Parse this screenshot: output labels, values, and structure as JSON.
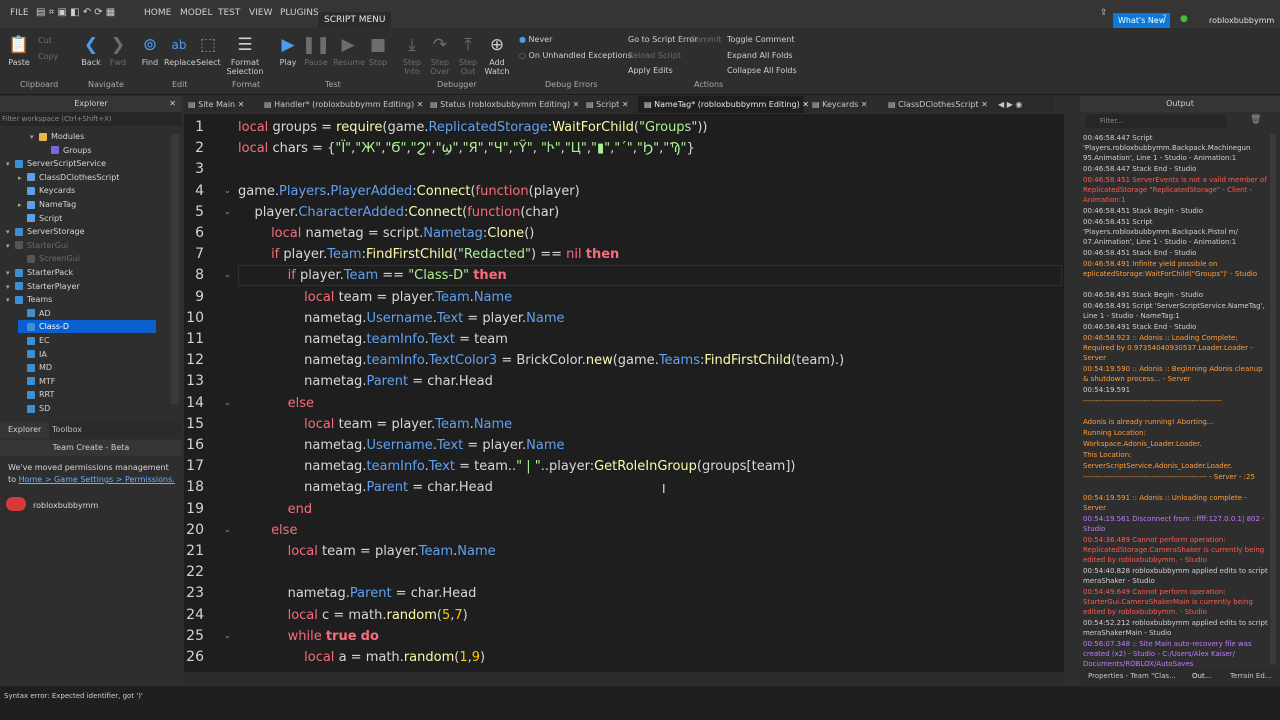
{
  "menu": {
    "file": "FILE",
    "tabs": [
      "HOME",
      "MODEL",
      "TEST",
      "VIEW",
      "PLUGINS",
      "SCRIPT MENU"
    ],
    "whats_new": "What's New",
    "username": "robloxbubbymm"
  },
  "ribbon": {
    "clipboard": {
      "paste": "Paste",
      "cut": "Cut",
      "copy": "Copy",
      "label": "Clipboard"
    },
    "navigate": {
      "back": "Back",
      "fwd": "Fwd",
      "label": "Navigate"
    },
    "edit": {
      "find": "Find",
      "replace": "Replace",
      "select": "Select",
      "label": "Edit"
    },
    "format": {
      "format_selection": "Format\nSelection",
      "label": "Format"
    },
    "test": {
      "play": "Play",
      "pause": "Pause",
      "resume": "Resume",
      "stop": "Stop",
      "label": "Test"
    },
    "debugger": {
      "step_into": "Step\nInto",
      "step_over": "Step\nOver",
      "step_out": "Step\nOut",
      "add_watch": "Add\nWatch",
      "label": "Debugger"
    },
    "debug_errors": {
      "never": "Never",
      "on_unhandled": "On Unhandled Exceptions",
      "label": "Debug Errors"
    },
    "actions": {
      "go_to_error": "Go to Script Error",
      "commit": "Commit",
      "reload": "Reload Script",
      "apply_edits": "Apply Edits",
      "toggle_comment": "Toggle Comment",
      "expand_all": "Expand All Folds",
      "collapse_all": "Collapse All Folds",
      "label": "Actions"
    }
  },
  "explorer": {
    "title": "Explorer",
    "filter_placeholder": "Filter workspace (Ctrl+Shift+X)",
    "items": [
      {
        "label": "Modules",
        "indent": 2,
        "icon": "folder"
      },
      {
        "label": "Groups",
        "indent": 3,
        "icon": "module"
      },
      {
        "label": "ServerScriptService",
        "indent": 0,
        "icon": "service"
      },
      {
        "label": "ClassDClothesScript",
        "indent": 1,
        "icon": "script"
      },
      {
        "label": "Keycards",
        "indent": 1,
        "icon": "script"
      },
      {
        "label": "NameTag",
        "indent": 1,
        "icon": "script"
      },
      {
        "label": "Script",
        "indent": 1,
        "icon": "script"
      },
      {
        "label": "ServerStorage",
        "indent": 0,
        "icon": "service"
      },
      {
        "label": "StarterGui",
        "indent": 0,
        "icon": "service",
        "dim": true
      },
      {
        "label": "ScreenGui",
        "indent": 1,
        "icon": "gui",
        "dim": true
      },
      {
        "label": "StarterPack",
        "indent": 0,
        "icon": "service"
      },
      {
        "label": "StarterPlayer",
        "indent": 0,
        "icon": "service"
      },
      {
        "label": "Teams",
        "indent": 0,
        "icon": "service"
      },
      {
        "label": "AD",
        "indent": 1,
        "icon": "team"
      },
      {
        "label": "Class-D",
        "indent": 1,
        "icon": "team",
        "selected": true
      },
      {
        "label": "EC",
        "indent": 1,
        "icon": "team"
      },
      {
        "label": "IA",
        "indent": 1,
        "icon": "team"
      },
      {
        "label": "MD",
        "indent": 1,
        "icon": "team"
      },
      {
        "label": "MTF",
        "indent": 1,
        "icon": "team"
      },
      {
        "label": "RRT",
        "indent": 1,
        "icon": "team"
      },
      {
        "label": "SD",
        "indent": 1,
        "icon": "team"
      }
    ],
    "bottom_tabs": [
      "Explorer",
      "Toolbox"
    ]
  },
  "team_create": {
    "title": "Team Create - Beta",
    "message": "We've moved permissions management to",
    "link": "Home > Game Settings > Permissions.",
    "user": "robloxbubbymm"
  },
  "editor_tabs": [
    "Site Main",
    "Handler* (robloxbubbymm Editing)",
    "Status (robloxbubbymm Editing)",
    "Script",
    "NameTag* (robloxbubbymm Editing)",
    "Keycards",
    "ClassDClothesScript"
  ],
  "code_lines": [
    "local groups = require(game.ReplicatedStorage:WaitForChild(\"Groups\"))",
    "local chars = {\"Ϊ\",\"Ж\",\"Ϭ\",\"Ϩ\",\"ϣ\",\"Я\",\"Ч\",\"Ϋ\", \"Ⴡ\",\"Ц\",\"▮\",\"ˊ\",\"Ϧ\",\"Ϡ\"}",
    "",
    "game.Players.PlayerAdded:Connect(function(player)",
    "    player.CharacterAdded:Connect(function(char)",
    "        local nametag = script.Nametag:Clone()",
    "        if player.Team:FindFirstChild(\"Redacted\") == nil then",
    "            if player.Team == \"Class-D\" then",
    "                local team = player.Team.Name",
    "                nametag.Username.Text = player.Name",
    "                nametag.teamInfo.Text = team",
    "                nametag.teamInfo.TextColor3 = BrickColor.new(game.Teams:FindFirstChild(team).)",
    "                nametag.Parent = char.Head",
    "            else",
    "                local team = player.Team.Name",
    "                nametag.Username.Text = player.Name",
    "                nametag.teamInfo.Text = team..\" | \"..player:GetRoleInGroup(groups[team])",
    "                nametag.Parent = char.Head",
    "            end",
    "        else",
    "            local team = player.Team.Name",
    "",
    "            nametag.Parent = char.Head",
    "            local c = math.random(5,7)",
    "            while true do",
    "                local a = math.random(1,9)"
  ],
  "line_numbers": [
    "1",
    "2",
    "3",
    "4",
    "5",
    "6",
    "7",
    "8",
    "9",
    "10",
    "11",
    "12",
    "13",
    "14",
    "15",
    "16",
    "17",
    "18",
    "19",
    "20",
    "21",
    "22",
    "23",
    "24",
    "25",
    "26"
  ],
  "output": {
    "title": "Output",
    "filter_placeholder": "Filter...",
    "lines": [
      {
        "t": "00:46:58.447  Script 'Players.robloxbubbymm.Backpack.Machinegun 95.Animation', Line 1 - Studio - Animation:1",
        "c": "normal"
      },
      {
        "t": "00:46:58.447  Stack End - Studio",
        "c": "normal"
      },
      {
        "t": "00:46:58.451  ServerEvents is not a valid member of ReplicatedStorage \"ReplicatedStorage\" - Client - Animation:1",
        "c": "red"
      },
      {
        "t": "00:46:58.451  Stack Begin - Studio",
        "c": "normal"
      },
      {
        "t": "00:46:58.451  Script 'Players.robloxbubbymm.Backpack.Pistol m/ 07.Animation', Line 1 - Studio - Animation:1",
        "c": "normal"
      },
      {
        "t": "00:46:58.451  Stack End - Studio",
        "c": "normal"
      },
      {
        "t": "00:46:58.491  Infinite yield possible on eplicatedStorage:WaitForChild(\"Groups\")' - Studio",
        "c": "orange"
      },
      {
        "t": "00:46:58.491  Stack Begin - Studio",
        "c": "normal"
      },
      {
        "t": "00:46:58.491  Script 'ServerScriptService.NameTag', Line 1 - Studio - NameTag:1",
        "c": "normal"
      },
      {
        "t": "00:46:58.491  Stack End - Studio",
        "c": "normal"
      },
      {
        "t": "00:46:58.923  :: Adonis :: Loading Complete; Required by 0.97354040930537.Loader.Loader - Server",
        "c": "orange"
      },
      {
        "t": "00:54:19.590  :: Adonis :: Beginning Adonis cleanup & shutdown process... - Server",
        "c": "orange"
      },
      {
        "t": "00:54:19.591",
        "c": "normal"
      },
      {
        "t": "-------------------------------------------------------",
        "c": "orange"
      },
      {
        "t": "Adonis is already running! Aborting...",
        "c": "orange"
      },
      {
        "t": "Running Location:",
        "c": "orange"
      },
      {
        "t": "Workspace.Adonis_Loader.Loader.",
        "c": "orange"
      },
      {
        "t": "This Location:",
        "c": "orange"
      },
      {
        "t": "ServerScriptService.Adonis_Loader.Loader.",
        "c": "orange"
      },
      {
        "t": "------------------------------------------------- - Server - :25",
        "c": "orange"
      },
      {
        "t": "00:54:19.591  :: Adonis :: Unloading complete - Server",
        "c": "orange"
      },
      {
        "t": "00:54:19.561  Disconnect from ::ffff:127.0.0.1| 802 - Studio",
        "c": "purple"
      },
      {
        "t": "00:54:36.489  Cannot perform operation: ReplicatedStorage.CameraShaker is currently being edited by robloxbubbymm. - Studio",
        "c": "red"
      },
      {
        "t": "00:54:40.828  robloxbubbymm applied edits to script meraShaker - Studio",
        "c": "normal"
      },
      {
        "t": "00:54:49.649  Cannot perform operation: StarterGui.CameraShakerMain is currently being edited by robloxbubbymm. - Studio",
        "c": "red"
      },
      {
        "t": "00:54:52.212  robloxbubbymm applied edits to script meraShakerMain - Studio",
        "c": "normal"
      },
      {
        "t": "00:56:07.348  :: Site Main  auto-recovery file was created (x2) - Studio - C:/Users/Alex Kaiser/ Documents/ROBLOX/AutoSaves",
        "c": "purple"
      }
    ],
    "bottom_tabs": [
      "Properties - Team \"Clas...",
      "Out...",
      "Terrain Ed..."
    ]
  },
  "status_bar": "Syntax error: Expected identifier, got ')'"
}
